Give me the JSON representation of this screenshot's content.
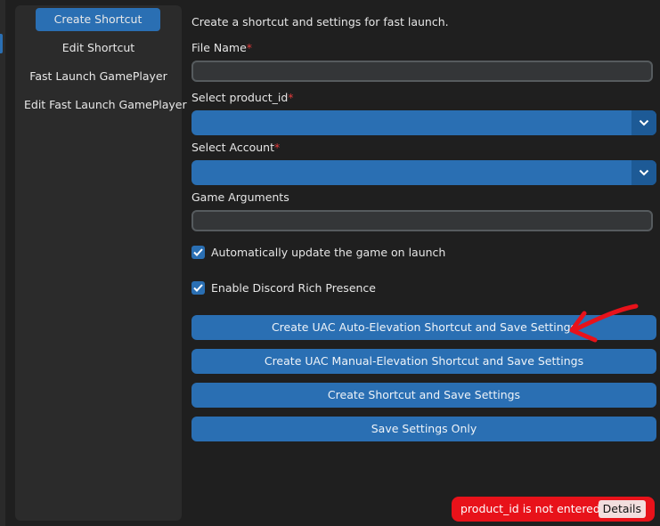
{
  "sidebar": {
    "items": [
      {
        "label": "Create Shortcut"
      },
      {
        "label": "Edit Shortcut"
      },
      {
        "label": "Fast Launch GamePlayer"
      },
      {
        "label": "Edit Fast Launch GamePlayer"
      }
    ]
  },
  "form": {
    "description": "Create a shortcut and settings for fast launch.",
    "file_name_label": "File Name",
    "file_name_value": "",
    "product_label": "Select product_id",
    "product_value": "",
    "account_label": "Select Account",
    "account_value": "",
    "args_label": "Game Arguments",
    "args_value": "",
    "required_mark": "*",
    "auto_update_label": "Automatically update the game on launch",
    "auto_update_checked": true,
    "discord_label": "Enable Discord Rich Presence",
    "discord_checked": true
  },
  "buttons": {
    "uac_auto": "Create UAC Auto-Elevation Shortcut and Save Settings",
    "uac_manual": "Create UAC Manual-Elevation Shortcut and Save Settings",
    "create": "Create Shortcut and Save Settings",
    "save_only": "Save Settings Only"
  },
  "toast": {
    "message": "product_id is not entered.",
    "details": "Details"
  },
  "colors": {
    "accent": "#2a6fb3",
    "error": "#e8121a",
    "annotation_arrow": "#e8121a"
  }
}
